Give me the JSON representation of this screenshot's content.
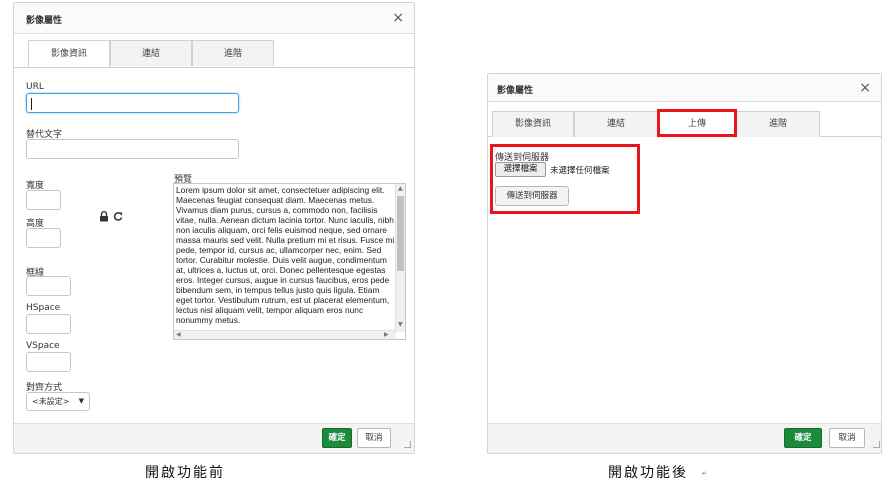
{
  "left_dialog": {
    "title": "影像屬性",
    "close_glyph": "×",
    "tabs": [
      {
        "label": "影像資訊",
        "active": true
      },
      {
        "label": "連結",
        "active": false
      },
      {
        "label": "進階",
        "active": false
      }
    ],
    "url": {
      "label": "URL",
      "value": ""
    },
    "alt_text": {
      "label": "替代文字",
      "value": ""
    },
    "width": {
      "label": "寬度",
      "value": ""
    },
    "height": {
      "label": "高度",
      "value": ""
    },
    "lock_icon": "lock-icon",
    "reset_icon": "refresh-icon",
    "border": {
      "label": "框線",
      "value": ""
    },
    "hspace": {
      "label": "HSpace",
      "value": ""
    },
    "vspace": {
      "label": "VSpace",
      "value": ""
    },
    "align": {
      "label": "對齊方式",
      "selected": "<未設定>"
    },
    "preview": {
      "label": "預覽",
      "text": "Lorem ipsum dolor sit amet, consectetuer adipiscing elit. Maecenas feugiat consequat diam. Maecenas metus. Vivamus diam purus, cursus a, commodo non, facilisis vitae, nulla. Aenean dictum lacinia tortor. Nunc iaculis, nibh non iaculis aliquam, orci felis euismod neque, sed ornare massa mauris sed velit. Nulla pretium mi et risus. Fusce mi pede, tempor id, cursus ac, ullamcorper nec, enim. Sed tortor. Curabitur molestie. Duis velit augue, condimentum at, ultrices a, luctus ut, orci. Donec pellentesque egestas eros. Integer cursus, augue in cursus faucibus, eros pede bibendum sem, in tempus tellus justo quis ligula. Etiam eget tortor. Vestibulum rutrum, est ut placerat elementum, lectus nisl aliquam velit, tempor aliquam eros nunc nonummy metus."
    },
    "ok_label": "確定",
    "cancel_label": "取消"
  },
  "right_dialog": {
    "title": "影像屬性",
    "close_glyph": "×",
    "tabs": [
      {
        "label": "影像資訊",
        "active": false
      },
      {
        "label": "連結",
        "active": false
      },
      {
        "label": "上傳",
        "active": true
      },
      {
        "label": "進階",
        "active": false
      }
    ],
    "upload": {
      "label": "傳送到伺服器",
      "choose_file_label": "選擇檔案",
      "no_file_text": "未選擇任何檔案",
      "send_button_label": "傳送到伺服器"
    },
    "ok_label": "確定",
    "cancel_label": "取消"
  },
  "captions": {
    "before": "開啟功能前",
    "after": "開啟功能後",
    "after_mark": "↵"
  },
  "colors": {
    "ok_button": "#1c8a3b",
    "highlight": "#e8141e",
    "focus_border": "#4aa1e0"
  }
}
